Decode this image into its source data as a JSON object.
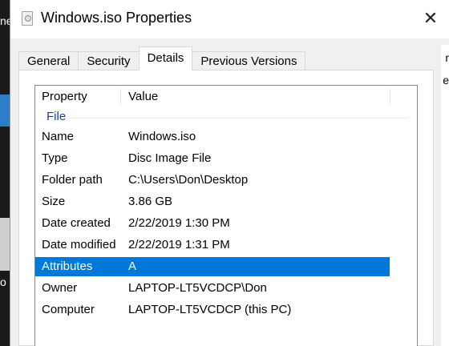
{
  "window": {
    "title": "Windows.iso Properties",
    "close_glyph": "✕"
  },
  "tabs": [
    {
      "label": "General",
      "active": false
    },
    {
      "label": "Security",
      "active": false
    },
    {
      "label": "Details",
      "active": true
    },
    {
      "label": "Previous Versions",
      "active": false
    }
  ],
  "details": {
    "columns": {
      "property": "Property",
      "value": "Value"
    },
    "group": "File",
    "rows": [
      {
        "property": "Name",
        "value": "Windows.iso",
        "selected": false
      },
      {
        "property": "Type",
        "value": "Disc Image File",
        "selected": false
      },
      {
        "property": "Folder path",
        "value": "C:\\Users\\Don\\Desktop",
        "selected": false
      },
      {
        "property": "Size",
        "value": "3.86 GB",
        "selected": false
      },
      {
        "property": "Date created",
        "value": "2/22/2019 1:30 PM",
        "selected": false
      },
      {
        "property": "Date modified",
        "value": "2/22/2019 1:31 PM",
        "selected": false
      },
      {
        "property": "Attributes",
        "value": "A",
        "selected": true
      },
      {
        "property": "Owner",
        "value": "LAPTOP-LT5VCDCP\\Don",
        "selected": false
      },
      {
        "property": "Computer",
        "value": "LAPTOP-LT5VCDCP (this PC)",
        "selected": false
      }
    ]
  },
  "background": {
    "left_fragments": [
      "ne",
      "o"
    ],
    "right_fragments": [
      "r",
      "e"
    ]
  },
  "colors": {
    "selection": "#0078d7",
    "group_label": "#1e3f9c",
    "dialog_bg": "#f0f0f0"
  }
}
